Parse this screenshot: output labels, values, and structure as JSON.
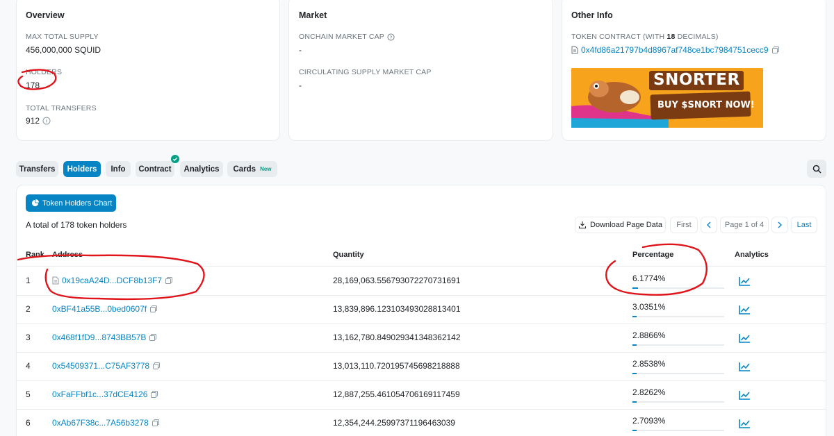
{
  "overview": {
    "title": "Overview",
    "max_supply_label": "MAX TOTAL SUPPLY",
    "max_supply_value": "456,000,000 SQUID",
    "holders_label": "HOLDERS",
    "holders_value": "178",
    "transfers_label": "TOTAL TRANSFERS",
    "transfers_value": "912"
  },
  "market": {
    "title": "Market",
    "onchain_cap_label": "ONCHAIN MARKET CAP",
    "onchain_cap_value": "-",
    "circ_cap_label": "CIRCULATING SUPPLY MARKET CAP",
    "circ_cap_value": "-"
  },
  "other": {
    "title": "Other Info",
    "contract_label_pre": "TOKEN CONTRACT (WITH ",
    "contract_decimals": "18",
    "contract_label_post": " DECIMALS)",
    "contract_address": "0x4fd86a21797b4d8967af748ce1bc7984751cecc9",
    "ad_title": "SNORTER",
    "ad_cta": "BUY $SNORT NOW!"
  },
  "tabs": [
    {
      "label": "Transfers"
    },
    {
      "label": "Holders"
    },
    {
      "label": "Info"
    },
    {
      "label": "Contract"
    },
    {
      "label": "Analytics"
    },
    {
      "label": "Cards",
      "badge": "New"
    }
  ],
  "holders_panel": {
    "chart_button": "Token Holders Chart",
    "summary": "A total of 178 token holders",
    "download": "Download Page Data",
    "first": "First",
    "page": "Page 1 of 4",
    "last": "Last"
  },
  "table": {
    "headers": {
      "rank": "Rank",
      "address": "Address",
      "quantity": "Quantity",
      "percentage": "Percentage",
      "analytics": "Analytics"
    },
    "rows": [
      {
        "rank": "1",
        "address": "0x19caA24D...DCF8b13F7",
        "quantity": "28,169,063.556793072270731691",
        "percentage": "6.1774%",
        "pct": 6.1774,
        "contract": true
      },
      {
        "rank": "2",
        "address": "0xBF41a55B...0bed0607f",
        "quantity": "13,839,896.123103493028813401",
        "percentage": "3.0351%",
        "pct": 3.0351
      },
      {
        "rank": "3",
        "address": "0x468f1fD9...8743BB57B",
        "quantity": "13,162,780.849029341348362142",
        "percentage": "2.8866%",
        "pct": 2.8866
      },
      {
        "rank": "4",
        "address": "0x54509371...C75AF3778",
        "quantity": "13,013,110.720195745698218888",
        "percentage": "2.8538%",
        "pct": 2.8538
      },
      {
        "rank": "5",
        "address": "0xFaFFbf1c...37dCE4126",
        "quantity": "12,887,255.461054706169117459",
        "percentage": "2.8262%",
        "pct": 2.8262
      },
      {
        "rank": "6",
        "address": "0xAb67F38c...7A56b3278",
        "quantity": "12,354,244.25997371196463039",
        "percentage": "2.7093%",
        "pct": 2.7093
      }
    ]
  },
  "colors": {
    "accent": "#0784c3",
    "annotation": "#e0151b"
  }
}
